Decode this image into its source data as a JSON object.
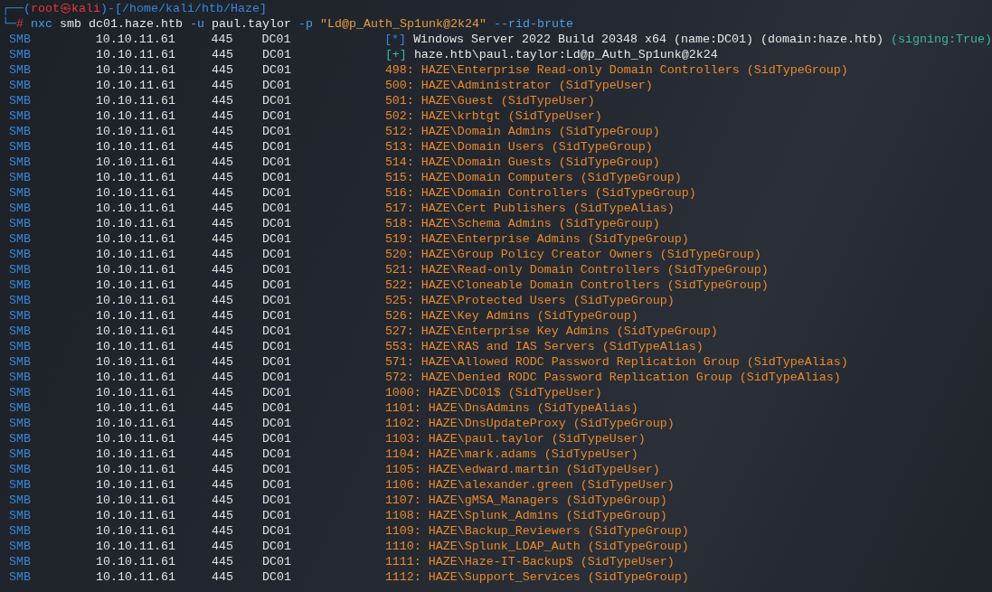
{
  "prompt": [
    {
      "text": "┌──(",
      "kind": "frame"
    },
    {
      "text": "root㉿kali",
      "kind": "user"
    },
    {
      "text": ")-[",
      "kind": "frame"
    },
    {
      "text": "/home/kali/htb/Haze",
      "kind": "path"
    },
    {
      "text": "]",
      "kind": "frame"
    }
  ],
  "command_line": {
    "prefix": [
      {
        "text": "└─",
        "kind": "frame"
      },
      {
        "text": "#",
        "kind": "user"
      }
    ],
    "tokens": [
      {
        "text": "nxc",
        "kind": "cmd"
      },
      {
        "text": "smb",
        "kind": "arg"
      },
      {
        "text": "dc01.haze.htb",
        "kind": "arg"
      },
      {
        "text": "-u",
        "kind": "flag"
      },
      {
        "text": "paul.taylor",
        "kind": "arg"
      },
      {
        "text": "-p",
        "kind": "flag"
      },
      {
        "text": "\"Ld@p_Auth_Sp1unk@2k24\"",
        "kind": "string"
      },
      {
        "text": "--rid-brute",
        "kind": "flag"
      }
    ]
  },
  "rows": [
    {
      "protocol": "SMB",
      "ip": "10.10.11.61",
      "port": "445",
      "host": "DC01",
      "message": [
        {
          "text": "[*]",
          "kind": "info"
        },
        {
          "text": "Windows Server 2022 Build 20348 x64 (name:DC01) (domain:haze.htb)",
          "kind": "text"
        },
        {
          "text": "(signing:True)",
          "kind": "highlight"
        }
      ]
    },
    {
      "protocol": "SMB",
      "ip": "10.10.11.61",
      "port": "445",
      "host": "DC01",
      "message": [
        {
          "text": "[+]",
          "kind": "success"
        },
        {
          "text": "haze.htb\\paul.taylor:Ld@p_Auth_Sp1unk@2k24",
          "kind": "text"
        }
      ]
    },
    {
      "protocol": "SMB",
      "ip": "10.10.11.61",
      "port": "445",
      "host": "DC01",
      "message": [
        {
          "text": "498: HAZE\\Enterprise Read-only Domain Controllers (SidTypeGroup)",
          "kind": "result"
        }
      ]
    },
    {
      "protocol": "SMB",
      "ip": "10.10.11.61",
      "port": "445",
      "host": "DC01",
      "message": [
        {
          "text": "500: HAZE\\Administrator (SidTypeUser)",
          "kind": "result"
        }
      ]
    },
    {
      "protocol": "SMB",
      "ip": "10.10.11.61",
      "port": "445",
      "host": "DC01",
      "message": [
        {
          "text": "501: HAZE\\Guest (SidTypeUser)",
          "kind": "result"
        }
      ]
    },
    {
      "protocol": "SMB",
      "ip": "10.10.11.61",
      "port": "445",
      "host": "DC01",
      "message": [
        {
          "text": "502: HAZE\\krbtgt (SidTypeUser)",
          "kind": "result"
        }
      ]
    },
    {
      "protocol": "SMB",
      "ip": "10.10.11.61",
      "port": "445",
      "host": "DC01",
      "message": [
        {
          "text": "512: HAZE\\Domain Admins (SidTypeGroup)",
          "kind": "result"
        }
      ]
    },
    {
      "protocol": "SMB",
      "ip": "10.10.11.61",
      "port": "445",
      "host": "DC01",
      "message": [
        {
          "text": "513: HAZE\\Domain Users (SidTypeGroup)",
          "kind": "result"
        }
      ]
    },
    {
      "protocol": "SMB",
      "ip": "10.10.11.61",
      "port": "445",
      "host": "DC01",
      "message": [
        {
          "text": "514: HAZE\\Domain Guests (SidTypeGroup)",
          "kind": "result"
        }
      ]
    },
    {
      "protocol": "SMB",
      "ip": "10.10.11.61",
      "port": "445",
      "host": "DC01",
      "message": [
        {
          "text": "515: HAZE\\Domain Computers (SidTypeGroup)",
          "kind": "result"
        }
      ]
    },
    {
      "protocol": "SMB",
      "ip": "10.10.11.61",
      "port": "445",
      "host": "DC01",
      "message": [
        {
          "text": "516: HAZE\\Domain Controllers (SidTypeGroup)",
          "kind": "result"
        }
      ]
    },
    {
      "protocol": "SMB",
      "ip": "10.10.11.61",
      "port": "445",
      "host": "DC01",
      "message": [
        {
          "text": "517: HAZE\\Cert Publishers (SidTypeAlias)",
          "kind": "result"
        }
      ]
    },
    {
      "protocol": "SMB",
      "ip": "10.10.11.61",
      "port": "445",
      "host": "DC01",
      "message": [
        {
          "text": "518: HAZE\\Schema Admins (SidTypeGroup)",
          "kind": "result"
        }
      ]
    },
    {
      "protocol": "SMB",
      "ip": "10.10.11.61",
      "port": "445",
      "host": "DC01",
      "message": [
        {
          "text": "519: HAZE\\Enterprise Admins (SidTypeGroup)",
          "kind": "result"
        }
      ]
    },
    {
      "protocol": "SMB",
      "ip": "10.10.11.61",
      "port": "445",
      "host": "DC01",
      "message": [
        {
          "text": "520: HAZE\\Group Policy Creator Owners (SidTypeGroup)",
          "kind": "result"
        }
      ]
    },
    {
      "protocol": "SMB",
      "ip": "10.10.11.61",
      "port": "445",
      "host": "DC01",
      "message": [
        {
          "text": "521: HAZE\\Read-only Domain Controllers (SidTypeGroup)",
          "kind": "result"
        }
      ]
    },
    {
      "protocol": "SMB",
      "ip": "10.10.11.61",
      "port": "445",
      "host": "DC01",
      "message": [
        {
          "text": "522: HAZE\\Cloneable Domain Controllers (SidTypeGroup)",
          "kind": "result"
        }
      ]
    },
    {
      "protocol": "SMB",
      "ip": "10.10.11.61",
      "port": "445",
      "host": "DC01",
      "message": [
        {
          "text": "525: HAZE\\Protected Users (SidTypeGroup)",
          "kind": "result"
        }
      ]
    },
    {
      "protocol": "SMB",
      "ip": "10.10.11.61",
      "port": "445",
      "host": "DC01",
      "message": [
        {
          "text": "526: HAZE\\Key Admins (SidTypeGroup)",
          "kind": "result"
        }
      ]
    },
    {
      "protocol": "SMB",
      "ip": "10.10.11.61",
      "port": "445",
      "host": "DC01",
      "message": [
        {
          "text": "527: HAZE\\Enterprise Key Admins (SidTypeGroup)",
          "kind": "result"
        }
      ]
    },
    {
      "protocol": "SMB",
      "ip": "10.10.11.61",
      "port": "445",
      "host": "DC01",
      "message": [
        {
          "text": "553: HAZE\\RAS and IAS Servers (SidTypeAlias)",
          "kind": "result"
        }
      ]
    },
    {
      "protocol": "SMB",
      "ip": "10.10.11.61",
      "port": "445",
      "host": "DC01",
      "message": [
        {
          "text": "571: HAZE\\Allowed RODC Password Replication Group (SidTypeAlias)",
          "kind": "result"
        }
      ]
    },
    {
      "protocol": "SMB",
      "ip": "10.10.11.61",
      "port": "445",
      "host": "DC01",
      "message": [
        {
          "text": "572: HAZE\\Denied RODC Password Replication Group (SidTypeAlias)",
          "kind": "result"
        }
      ]
    },
    {
      "protocol": "SMB",
      "ip": "10.10.11.61",
      "port": "445",
      "host": "DC01",
      "message": [
        {
          "text": "1000: HAZE\\DC01$ (SidTypeUser)",
          "kind": "result"
        }
      ]
    },
    {
      "protocol": "SMB",
      "ip": "10.10.11.61",
      "port": "445",
      "host": "DC01",
      "message": [
        {
          "text": "1101: HAZE\\DnsAdmins (SidTypeAlias)",
          "kind": "result"
        }
      ]
    },
    {
      "protocol": "SMB",
      "ip": "10.10.11.61",
      "port": "445",
      "host": "DC01",
      "message": [
        {
          "text": "1102: HAZE\\DnsUpdateProxy (SidTypeGroup)",
          "kind": "result"
        }
      ]
    },
    {
      "protocol": "SMB",
      "ip": "10.10.11.61",
      "port": "445",
      "host": "DC01",
      "message": [
        {
          "text": "1103: HAZE\\paul.taylor (SidTypeUser)",
          "kind": "result"
        }
      ]
    },
    {
      "protocol": "SMB",
      "ip": "10.10.11.61",
      "port": "445",
      "host": "DC01",
      "message": [
        {
          "text": "1104: HAZE\\mark.adams (SidTypeUser)",
          "kind": "result"
        }
      ]
    },
    {
      "protocol": "SMB",
      "ip": "10.10.11.61",
      "port": "445",
      "host": "DC01",
      "message": [
        {
          "text": "1105: HAZE\\edward.martin (SidTypeUser)",
          "kind": "result"
        }
      ]
    },
    {
      "protocol": "SMB",
      "ip": "10.10.11.61",
      "port": "445",
      "host": "DC01",
      "message": [
        {
          "text": "1106: HAZE\\alexander.green (SidTypeUser)",
          "kind": "result"
        }
      ]
    },
    {
      "protocol": "SMB",
      "ip": "10.10.11.61",
      "port": "445",
      "host": "DC01",
      "message": [
        {
          "text": "1107: HAZE\\gMSA_Managers (SidTypeGroup)",
          "kind": "result"
        }
      ]
    },
    {
      "protocol": "SMB",
      "ip": "10.10.11.61",
      "port": "445",
      "host": "DC01",
      "message": [
        {
          "text": "1108: HAZE\\Splunk_Admins (SidTypeGroup)",
          "kind": "result"
        }
      ]
    },
    {
      "protocol": "SMB",
      "ip": "10.10.11.61",
      "port": "445",
      "host": "DC01",
      "message": [
        {
          "text": "1109: HAZE\\Backup_Reviewers (SidTypeGroup)",
          "kind": "result"
        }
      ]
    },
    {
      "protocol": "SMB",
      "ip": "10.10.11.61",
      "port": "445",
      "host": "DC01",
      "message": [
        {
          "text": "1110: HAZE\\Splunk_LDAP_Auth (SidTypeGroup)",
          "kind": "result"
        }
      ]
    },
    {
      "protocol": "SMB",
      "ip": "10.10.11.61",
      "port": "445",
      "host": "DC01",
      "message": [
        {
          "text": "1111: HAZE\\Haze-IT-Backup$ (SidTypeUser)",
          "kind": "result"
        }
      ]
    },
    {
      "protocol": "SMB",
      "ip": "10.10.11.61",
      "port": "445",
      "host": "DC01",
      "message": [
        {
          "text": "1112: HAZE\\Support_Services (SidTypeGroup)",
          "kind": "result"
        }
      ]
    }
  ]
}
